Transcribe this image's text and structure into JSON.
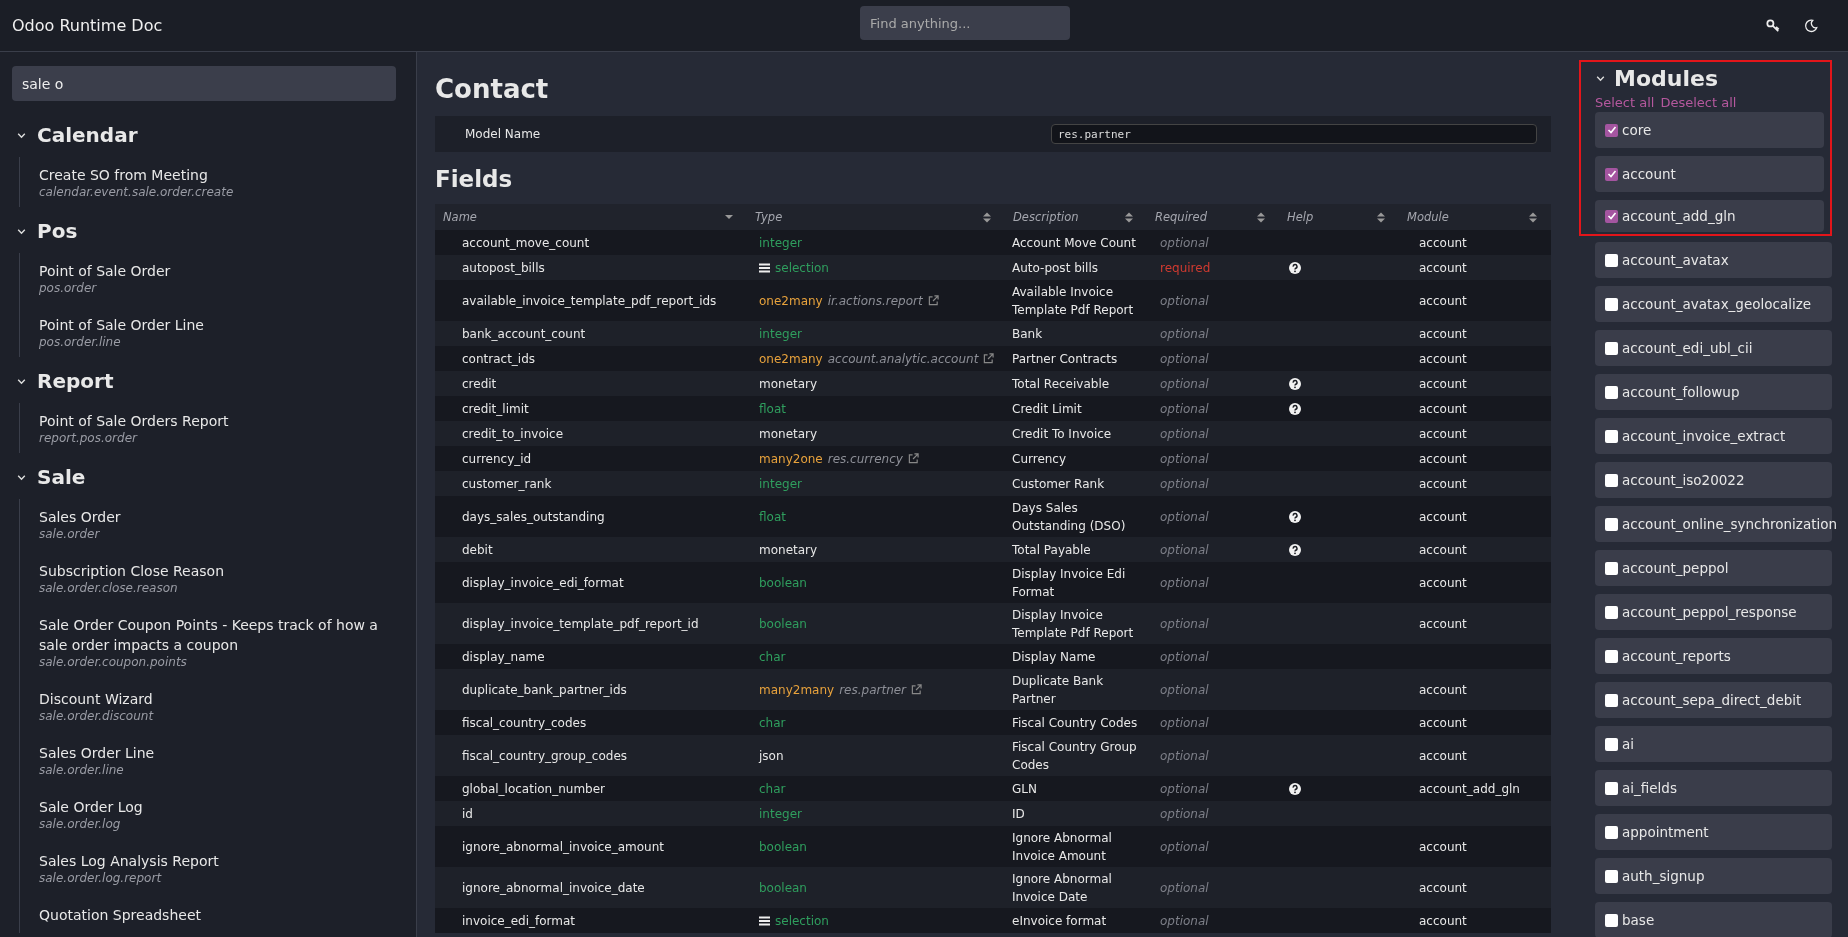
{
  "header": {
    "title": "Odoo Runtime Doc",
    "search": {
      "placeholder": "Find anything..."
    }
  },
  "sidebar": {
    "search": {
      "value": "sale o"
    },
    "groups": [
      {
        "title": "Calendar",
        "expanded": true,
        "children": [
          {
            "title": "Create SO from Meeting",
            "model": "calendar.event.sale.order.create"
          }
        ]
      },
      {
        "title": "Pos",
        "expanded": true,
        "children": [
          {
            "title": "Point of Sale Order",
            "model": "pos.order"
          },
          {
            "title": "Point of Sale Order Line",
            "model": "pos.order.line"
          }
        ]
      },
      {
        "title": "Report",
        "expanded": true,
        "children": [
          {
            "title": "Point of Sale Orders Report",
            "model": "report.pos.order"
          }
        ]
      },
      {
        "title": "Sale",
        "expanded": true,
        "children": [
          {
            "title": "Sales Order",
            "model": "sale.order"
          },
          {
            "title": "Subscription Close Reason",
            "model": "sale.order.close.reason"
          },
          {
            "title": "Sale Order Coupon Points - Keeps track of how a sale order impacts a coupon",
            "model": "sale.order.coupon.points"
          },
          {
            "title": "Discount Wizard",
            "model": "sale.order.discount"
          },
          {
            "title": "Sales Order Line",
            "model": "sale.order.line"
          },
          {
            "title": "Sale Order Log",
            "model": "sale.order.log"
          },
          {
            "title": "Sales Log Analysis Report",
            "model": "sale.order.log.report"
          },
          {
            "title": "Quotation Spreadsheet"
          }
        ]
      }
    ]
  },
  "main": {
    "title": "Contact",
    "model_label": "Model Name",
    "model_value": "res.partner",
    "fields_title": "Fields",
    "table": {
      "columns": [
        {
          "label": "Name",
          "sorted": true
        },
        {
          "label": "Type",
          "sorted": false
        },
        {
          "label": "Description",
          "sorted": false
        },
        {
          "label": "Required",
          "sorted": false
        },
        {
          "label": "Help",
          "sorted": false
        },
        {
          "label": "Module",
          "sorted": false
        }
      ],
      "rows": [
        {
          "name": "account_move_count",
          "type": "integer",
          "kind": "basic",
          "description": "Account Move Count",
          "required": false,
          "required_label": "optional",
          "help": false,
          "module": "account"
        },
        {
          "name": "autopost_bills",
          "type": "selection",
          "kind": "selection",
          "description": "Auto-post bills",
          "required": true,
          "required_label": "required",
          "help": true,
          "module": "account"
        },
        {
          "name": "available_invoice_template_pdf_report_ids",
          "type": "one2many",
          "kind": "relational",
          "relation": "ir.actions.report",
          "description": "Available Invoice Template Pdf Report",
          "required": false,
          "required_label": "optional",
          "help": false,
          "module": "account"
        },
        {
          "name": "bank_account_count",
          "type": "integer",
          "kind": "basic",
          "description": "Bank",
          "required": false,
          "required_label": "optional",
          "help": false,
          "module": "account"
        },
        {
          "name": "contract_ids",
          "type": "one2many",
          "kind": "relational",
          "relation": "account.analytic.account",
          "description": "Partner Contracts",
          "required": false,
          "required_label": "optional",
          "help": false,
          "module": "account"
        },
        {
          "name": "credit",
          "type": "monetary",
          "kind": "plain",
          "description": "Total Receivable",
          "required": false,
          "required_label": "optional",
          "help": true,
          "module": "account"
        },
        {
          "name": "credit_limit",
          "type": "float",
          "kind": "basic",
          "description": "Credit Limit",
          "required": false,
          "required_label": "optional",
          "help": true,
          "module": "account"
        },
        {
          "name": "credit_to_invoice",
          "type": "monetary",
          "kind": "plain",
          "description": "Credit To Invoice",
          "required": false,
          "required_label": "optional",
          "help": false,
          "module": "account"
        },
        {
          "name": "currency_id",
          "type": "many2one",
          "kind": "relational",
          "relation": "res.currency",
          "description": "Currency",
          "required": false,
          "required_label": "optional",
          "help": false,
          "module": "account"
        },
        {
          "name": "customer_rank",
          "type": "integer",
          "kind": "basic",
          "description": "Customer Rank",
          "required": false,
          "required_label": "optional",
          "help": false,
          "module": "account"
        },
        {
          "name": "days_sales_outstanding",
          "type": "float",
          "kind": "basic",
          "description": "Days Sales Outstanding (DSO)",
          "required": false,
          "required_label": "optional",
          "help": true,
          "module": "account"
        },
        {
          "name": "debit",
          "type": "monetary",
          "kind": "plain",
          "description": "Total Payable",
          "required": false,
          "required_label": "optional",
          "help": true,
          "module": "account"
        },
        {
          "name": "display_invoice_edi_format",
          "type": "boolean",
          "kind": "basic",
          "description": "Display Invoice Edi Format",
          "required": false,
          "required_label": "optional",
          "help": false,
          "module": "account"
        },
        {
          "name": "display_invoice_template_pdf_report_id",
          "type": "boolean",
          "kind": "basic",
          "description": "Display Invoice Template Pdf Report",
          "required": false,
          "required_label": "optional",
          "help": false,
          "module": "account"
        },
        {
          "name": "display_name",
          "type": "char",
          "kind": "basic",
          "description": "Display Name",
          "required": false,
          "required_label": "optional",
          "help": false
        },
        {
          "name": "duplicate_bank_partner_ids",
          "type": "many2many",
          "kind": "relational",
          "relation": "res.partner",
          "description": "Duplicate Bank Partner",
          "required": false,
          "required_label": "optional",
          "help": false,
          "module": "account"
        },
        {
          "name": "fiscal_country_codes",
          "type": "char",
          "kind": "basic",
          "description": "Fiscal Country Codes",
          "required": false,
          "required_label": "optional",
          "help": false,
          "module": "account"
        },
        {
          "name": "fiscal_country_group_codes",
          "type": "json",
          "kind": "plain",
          "description": "Fiscal Country Group Codes",
          "required": false,
          "required_label": "optional",
          "help": false,
          "module": "account"
        },
        {
          "name": "global_location_number",
          "type": "char",
          "kind": "basic",
          "description": "GLN",
          "required": false,
          "required_label": "optional",
          "help": true,
          "module": "account_add_gln"
        },
        {
          "name": "id",
          "type": "integer",
          "kind": "basic",
          "description": "ID",
          "required": false,
          "required_label": "optional",
          "help": false
        },
        {
          "name": "ignore_abnormal_invoice_amount",
          "type": "boolean",
          "kind": "basic",
          "description": "Ignore Abnormal Invoice Amount",
          "required": false,
          "required_label": "optional",
          "help": false,
          "module": "account"
        },
        {
          "name": "ignore_abnormal_invoice_date",
          "type": "boolean",
          "kind": "basic",
          "description": "Ignore Abnormal Invoice Date",
          "required": false,
          "required_label": "optional",
          "help": false,
          "module": "account"
        },
        {
          "name": "invoice_edi_format",
          "type": "selection",
          "kind": "selection",
          "description": "eInvoice format",
          "required": false,
          "required_label": "optional",
          "help": false,
          "module": "account"
        }
      ]
    }
  },
  "modules": {
    "title": "Modules",
    "expanded": true,
    "select_all": "Select all",
    "deselect_all": "Deselect all",
    "items": [
      {
        "label": "core",
        "checked": true,
        "highlighted": true
      },
      {
        "label": "account",
        "checked": true,
        "highlighted": true
      },
      {
        "label": "account_add_gln",
        "checked": true,
        "highlighted": true
      },
      {
        "label": "account_avatax",
        "checked": false,
        "highlighted": false
      },
      {
        "label": "account_avatax_geolocalize",
        "checked": false,
        "highlighted": false
      },
      {
        "label": "account_edi_ubl_cii",
        "checked": false,
        "highlighted": false
      },
      {
        "label": "account_followup",
        "checked": false,
        "highlighted": false
      },
      {
        "label": "account_invoice_extract",
        "checked": false,
        "highlighted": false
      },
      {
        "label": "account_iso20022",
        "checked": false,
        "highlighted": false
      },
      {
        "label": "account_online_synchronization",
        "checked": false,
        "highlighted": false
      },
      {
        "label": "account_peppol",
        "checked": false,
        "highlighted": false
      },
      {
        "label": "account_peppol_response",
        "checked": false,
        "highlighted": false
      },
      {
        "label": "account_reports",
        "checked": false,
        "highlighted": false
      },
      {
        "label": "account_sepa_direct_debit",
        "checked": false,
        "highlighted": false
      },
      {
        "label": "ai",
        "checked": false,
        "highlighted": false
      },
      {
        "label": "ai_fields",
        "checked": false,
        "highlighted": false
      },
      {
        "label": "appointment",
        "checked": false,
        "highlighted": false
      },
      {
        "label": "auth_signup",
        "checked": false,
        "highlighted": false
      },
      {
        "label": "base",
        "checked": false,
        "highlighted": false
      }
    ]
  }
}
